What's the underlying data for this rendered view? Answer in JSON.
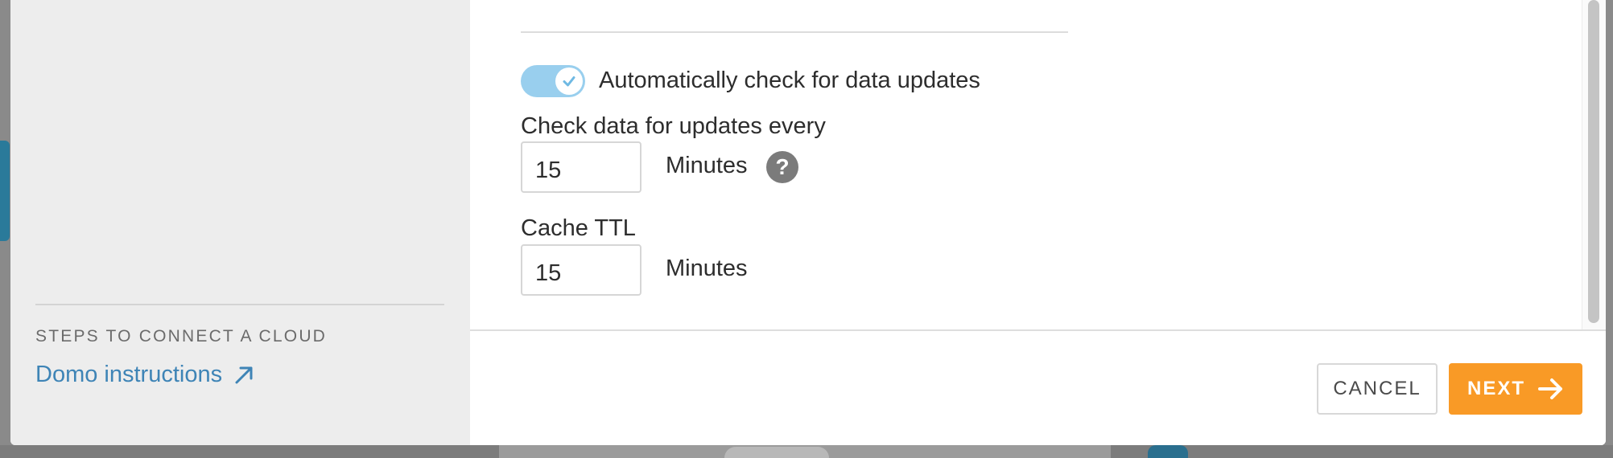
{
  "sidebar": {
    "steps_heading": "STEPS TO CONNECT A CLOUD",
    "instructions_link": "Domo instructions",
    "link_icon": "arrow-up-right-icon"
  },
  "settings": {
    "auto_check_toggle": {
      "label": "Automatically check for data updates",
      "enabled": true
    },
    "check_interval": {
      "label": "Check data for updates every",
      "value": "15",
      "unit": "Minutes",
      "help_icon": "question-circle-icon",
      "help_glyph": "?"
    },
    "cache_ttl": {
      "label": "Cache TTL",
      "value": "15",
      "unit": "Minutes"
    }
  },
  "footer": {
    "cancel_label": "CANCEL",
    "next_label": "NEXT",
    "next_icon": "arrow-right-icon"
  },
  "colors": {
    "accent_orange": "#f99a26",
    "link_blue": "#3e84b6",
    "toggle_on": "#99cfee",
    "sidebar_bg": "#ededed"
  }
}
